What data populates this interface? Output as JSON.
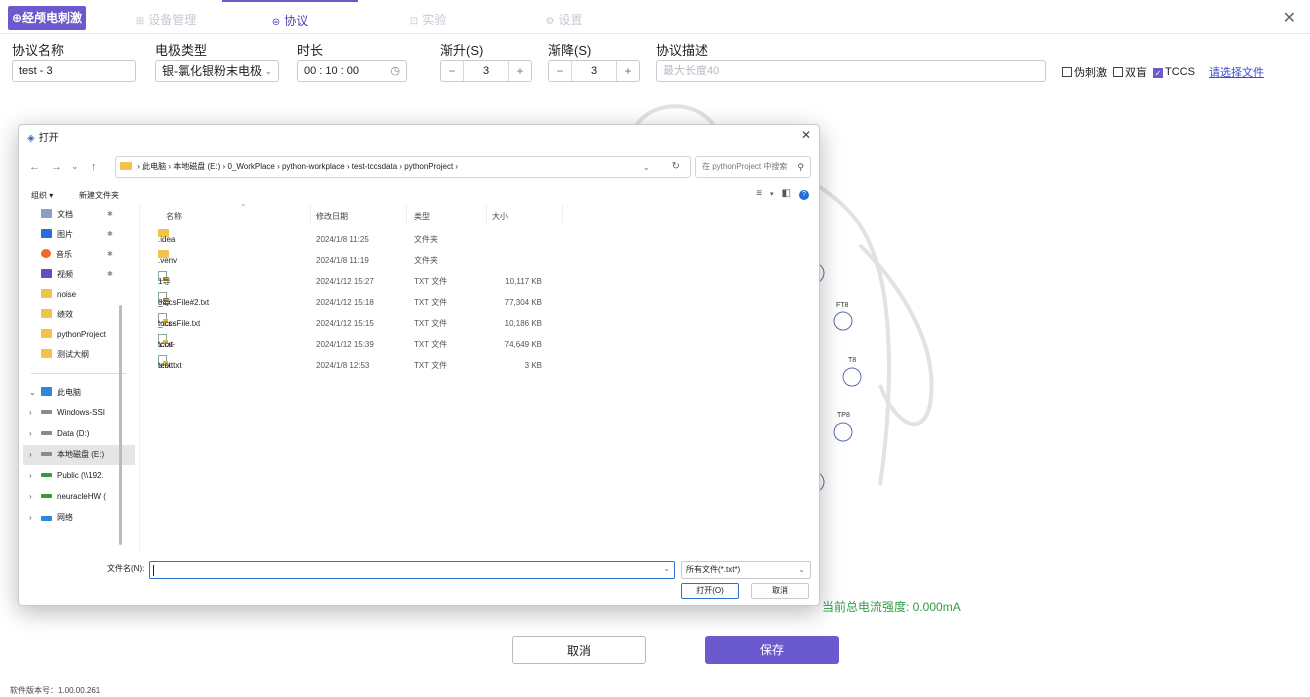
{
  "app": {
    "brand": "经颅电刺激",
    "close_glyph": "✕",
    "nav_tabs": [
      {
        "icon": "⊞",
        "label": "设备管理"
      },
      {
        "icon": "⊜",
        "label": "协议"
      },
      {
        "icon": "⊡",
        "label": "实验"
      },
      {
        "icon": "⚙",
        "label": "设置"
      }
    ],
    "active_tab": "协议"
  },
  "form": {
    "name_label": "协议名称",
    "name_value": "test - 3",
    "electrode_label": "电极类型",
    "electrode_value": "银-氯化银粉末电极",
    "duration_label": "时长",
    "duration_value": "00 : 10 : 00",
    "rampup_label": "渐升(S)",
    "rampup_value": "3",
    "rampdown_label": "渐降(S)",
    "rampdown_value": "3",
    "desc_label": "协议描述",
    "desc_placeholder": "最大长度40",
    "sham_label": "伪刺激",
    "blind_label": "双盲",
    "tccs_label": "TCCS",
    "file_link": "请选择文件"
  },
  "diagram": {
    "electrodes": [
      "FT8",
      "T8",
      "TP8"
    ],
    "current_text": "当前总电流强度: 0.000mA"
  },
  "footer": {
    "cancel": "取消",
    "save": "保存",
    "version": "软件版本号：1.00.00.261"
  },
  "dialog": {
    "title": "打开",
    "address": {
      "segments": [
        "此电脑",
        "本地磁盘 (E:)",
        "0_WorkPlace",
        "python-workplace",
        "test-tccsdata",
        "pythonProject"
      ]
    },
    "search_placeholder": "在 pythonProject 中搜索",
    "organize": "组织 ▾",
    "new_folder": "新建文件夹",
    "sidebar": [
      {
        "label": "文档",
        "icon": "doc",
        "pinned": true
      },
      {
        "label": "图片",
        "icon": "pic",
        "pinned": true
      },
      {
        "label": "音乐",
        "icon": "music",
        "pinned": true
      },
      {
        "label": "视频",
        "icon": "video",
        "pinned": true
      },
      {
        "label": "noise",
        "icon": "folder",
        "pinned": false
      },
      {
        "label": "绩效",
        "icon": "folder",
        "pinned": false
      },
      {
        "label": "pythonProject",
        "icon": "folder",
        "pinned": false
      },
      {
        "label": "测试大纲",
        "icon": "folder",
        "pinned": false
      },
      {
        "label": "此电脑",
        "icon": "pc",
        "toggle": "⌄"
      },
      {
        "label": "Windows-SSI",
        "icon": "drive",
        "toggle": "›"
      },
      {
        "label": "Data (D:)",
        "icon": "drive",
        "toggle": "›"
      },
      {
        "label": "本地磁盘 (E:)",
        "icon": "drive",
        "toggle": "›",
        "selected": true
      },
      {
        "label": "Public (\\\\192.",
        "icon": "drive",
        "toggle": "›"
      },
      {
        "label": "neuracleHW (",
        "icon": "drive",
        "toggle": "›"
      },
      {
        "label": "网络",
        "icon": "net",
        "toggle": "›"
      }
    ],
    "columns": [
      "名称",
      "修改日期",
      "类型",
      "大小"
    ],
    "files": [
      {
        "name": ".idea",
        "date": "2024/1/8 11:25",
        "type": "文件夹",
        "size": "",
        "kind": "folder"
      },
      {
        "name": ".venv",
        "date": "2024/1/8 11:19",
        "type": "文件夹",
        "size": "",
        "kind": "folder"
      },
      {
        "name": "1导_tccsFile#2.txt",
        "date": "2024/1/12 15:27",
        "type": "TXT 文件",
        "size": "10,117 KB",
        "kind": "txt"
      },
      {
        "name": "8导_tccsFile.txt",
        "date": "2024/1/12 15:18",
        "type": "TXT 文件",
        "size": "77,304 KB",
        "kind": "txt"
      },
      {
        "name": "tccs-1.txt",
        "date": "2024/1/12 15:15",
        "type": "TXT 文件",
        "size": "10,186 KB",
        "kind": "txt"
      },
      {
        "name": "tccs-8.txt",
        "date": "2024/1/12 15:39",
        "type": "TXT 文件",
        "size": "74,649 KB",
        "kind": "txt"
      },
      {
        "name": "test.txt",
        "date": "2024/1/8 12:53",
        "type": "TXT 文件",
        "size": "3 KB",
        "kind": "txt"
      }
    ],
    "filename_label": "文件名(N):",
    "filename_value": "",
    "filter": "所有文件(*.txt*)",
    "open_button": "打开(O)",
    "cancel_button": "取消"
  },
  "colors": {
    "accent": "#6a5acd",
    "current_green": "#2e9e43",
    "link": "#3b49d8"
  }
}
